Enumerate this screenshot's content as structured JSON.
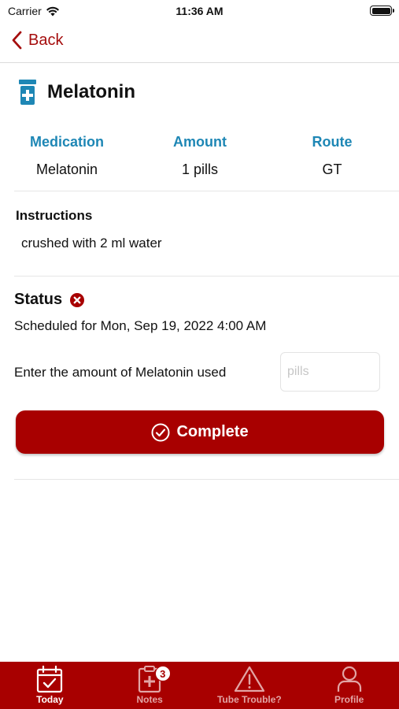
{
  "status_bar": {
    "carrier": "Carrier",
    "time": "11:36 AM"
  },
  "nav": {
    "back_label": "Back"
  },
  "medication": {
    "title": "Melatonin",
    "columns": [
      {
        "header": "Medication",
        "value": "Melatonin"
      },
      {
        "header": "Amount",
        "value": "1 pills"
      },
      {
        "header": "Route",
        "value": "GT"
      }
    ]
  },
  "instructions": {
    "label": "Instructions",
    "text": "crushed with 2 ml water"
  },
  "status": {
    "label": "Status",
    "scheduled": "Scheduled for Mon, Sep 19, 2022 4:00 AM"
  },
  "amount_entry": {
    "label": "Enter the amount of Melatonin used",
    "placeholder": "pills",
    "value": ""
  },
  "complete_button": {
    "label": "Complete"
  },
  "tabs": [
    {
      "label": "Today",
      "icon": "calendar-check-icon",
      "active": true
    },
    {
      "label": "Notes",
      "icon": "clipboard-medical-icon",
      "active": false,
      "badge": "3"
    },
    {
      "label": "Tube Trouble?",
      "icon": "warning-triangle-icon",
      "active": false
    },
    {
      "label": "Profile",
      "icon": "person-icon",
      "active": false
    }
  ],
  "colors": {
    "accent": "#a80000",
    "header_blue": "#1e87b5",
    "status_error": "#a80000"
  }
}
